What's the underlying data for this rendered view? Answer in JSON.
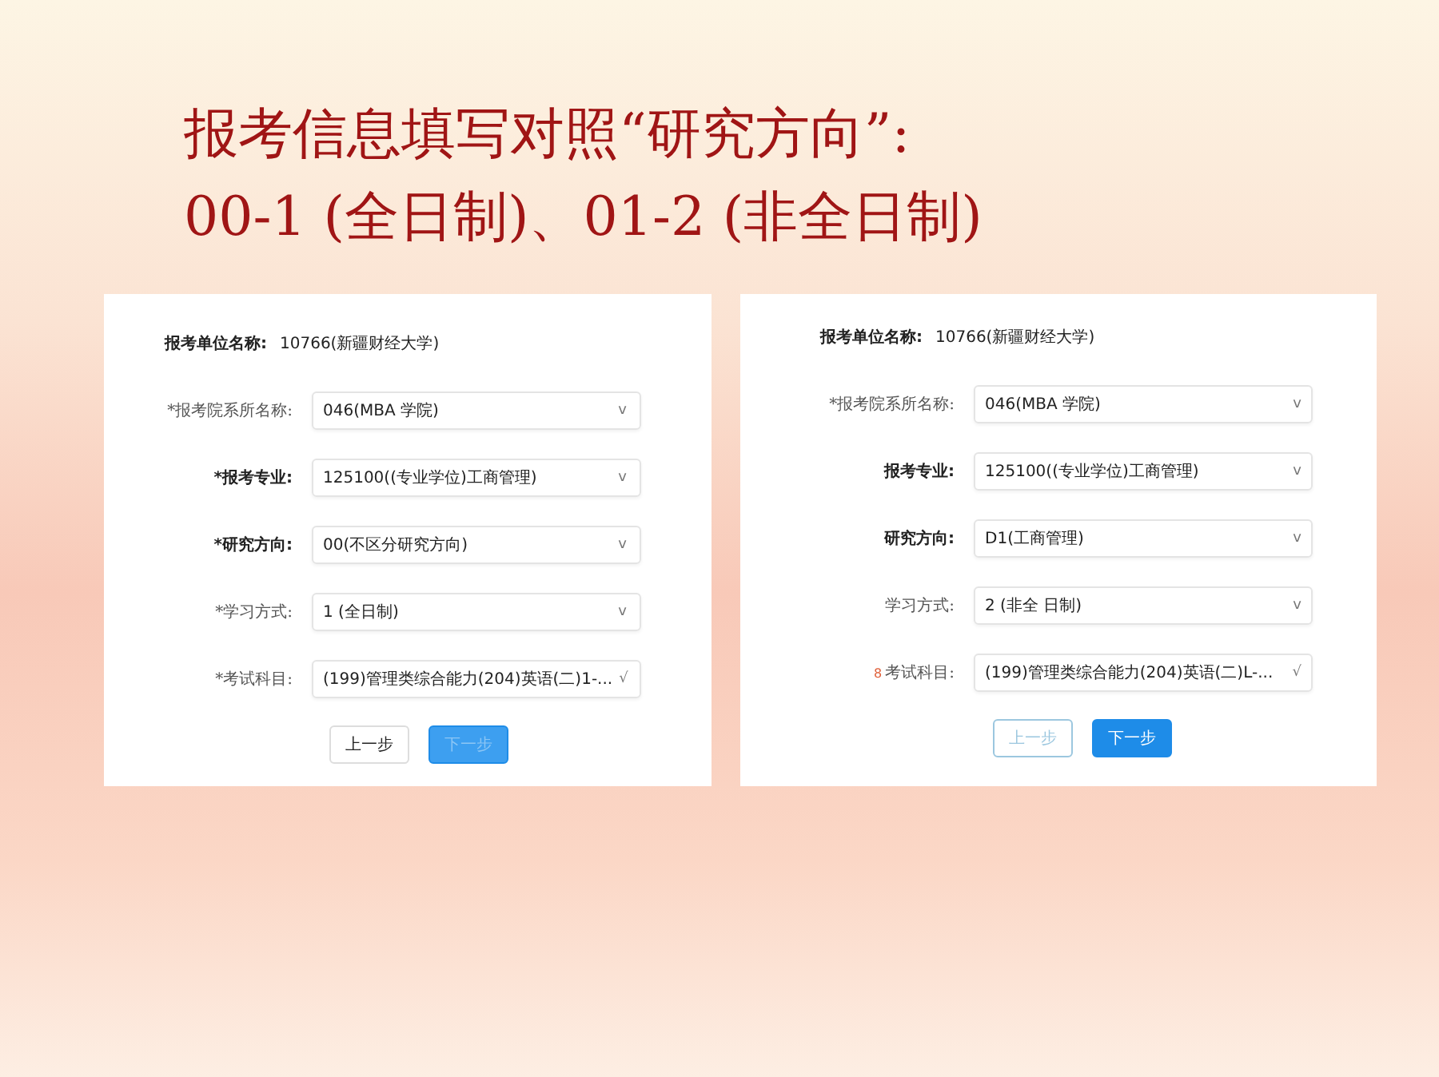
{
  "title": {
    "lines": [
      "报考信息填写对照“研究方向”:",
      "00-1 (全日制)、01-2 (非全日制)"
    ]
  },
  "forms": [
    {
      "unit_label": "报考单位名称:",
      "unit_value": "10766(新疆财经大学)",
      "fields": [
        {
          "label": "*报考院系所名称:",
          "value": "046(MBA  学院)",
          "arrow": "v"
        },
        {
          "label": "*报考专业:",
          "value": "125100((专业学位)工商管理)",
          "arrow": "v"
        },
        {
          "label": "*研究方向:",
          "value": "00(不区分研究方向)",
          "arrow": "v"
        },
        {
          "label": "*学习方式:",
          "value": "1  (全日制)",
          "arrow": "v"
        },
        {
          "label": "*考试科目:",
          "value": "(199)管理类综合能力(204)英语(二)1-...",
          "arrow": "√"
        }
      ],
      "buttons": [
        {
          "label": "上一步",
          "kind": "default",
          "disabled": false
        },
        {
          "label": "下一步",
          "kind": "primary",
          "disabled": true
        }
      ]
    },
    {
      "unit_label": "报考单位名称:",
      "unit_value": "10766(新疆财经大学)",
      "fields": [
        {
          "label": "*报考院系所名称:",
          "value": "046(MBA  学院)",
          "arrow": "v"
        },
        {
          "label": "报考专业:",
          "value": "125100((专业学位)工商管理)",
          "arrow": "v"
        },
        {
          "label": "研究方向:",
          "value": "D1(工商管理)",
          "arrow": "v"
        },
        {
          "label": "学习方式:",
          "value": "2  (非全  日制)",
          "arrow": "v"
        },
        {
          "mark": "8",
          "label": "考试科目:",
          "value": "(199)管理类综合能力(204)英语(二)L-...",
          "arrow": "√"
        }
      ],
      "buttons": [
        {
          "label": "上一步",
          "kind": "default",
          "disabled": true
        },
        {
          "label": "下一步",
          "kind": "primary",
          "disabled": false
        }
      ]
    }
  ]
}
